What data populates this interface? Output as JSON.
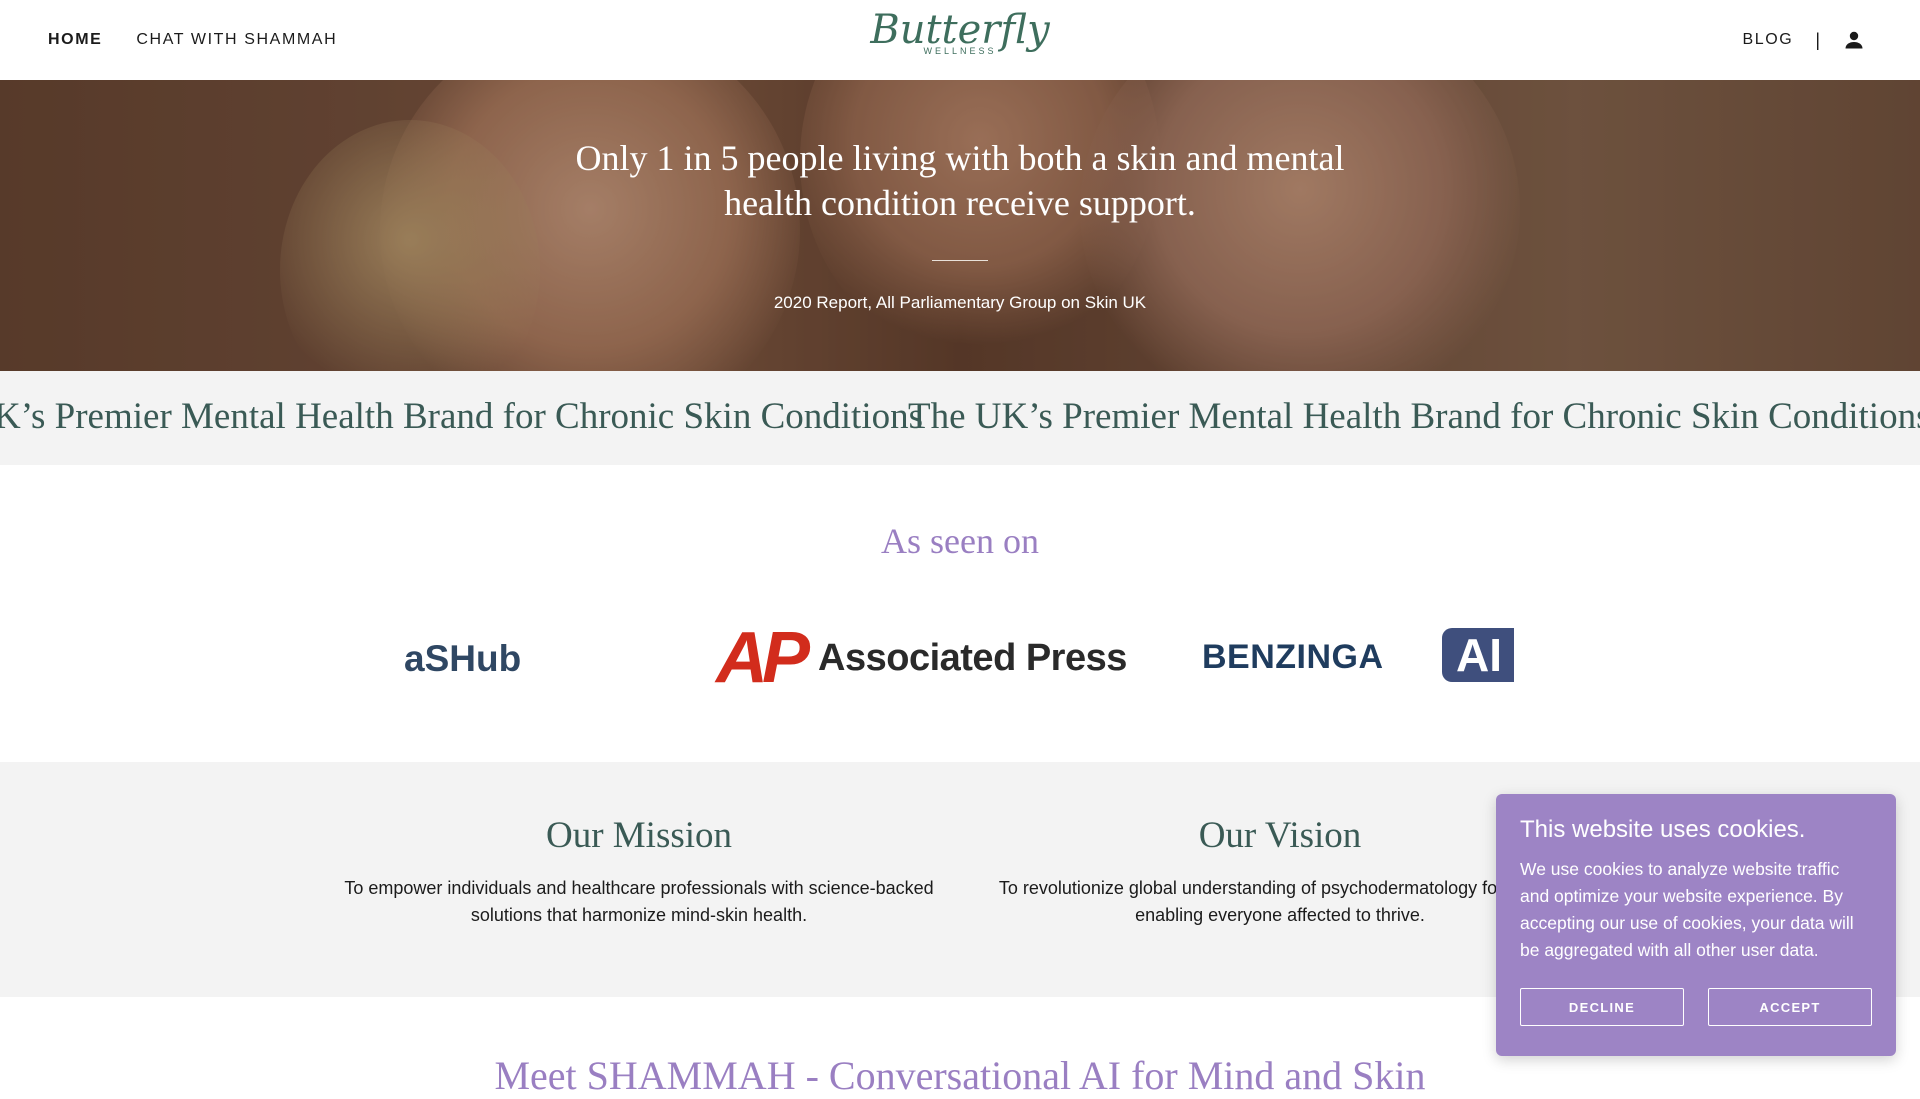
{
  "header": {
    "nav_left": [
      {
        "label": "HOME",
        "active": true
      },
      {
        "label": "CHAT WITH SHAMMAH",
        "active": false
      }
    ],
    "logo_word": "Butterfly",
    "logo_sub": "WELLNESS",
    "nav_right_blog": "BLOG",
    "separator": "|",
    "account_icon": "user-icon"
  },
  "hero": {
    "quote": "Only 1 in 5 people living with both a skin and mental health condition receive support.",
    "source": "2020 Report, All Parliamentary Group on Skin UK"
  },
  "marquee": {
    "items": [
      "K’s Premier Mental Health Brand for Chronic Skin Conditions",
      "The UK’s Premier Mental Health Brand for Chronic Skin Conditions"
    ]
  },
  "seen_on": {
    "title": "As seen on",
    "logos": {
      "partial_left": "aSHub",
      "ap_mark": "AP",
      "ap_text": "Associated Press",
      "benzinga": "BENZINGA",
      "partial_right": "AI"
    }
  },
  "mission": {
    "title": "Our Mission",
    "body": "To empower individuals and healthcare professionals with science-backed solutions that harmonize mind-skin health."
  },
  "vision": {
    "title": "Our Vision",
    "body": "To revolutionize global understanding of psychodermatology fo people, enabling everyone affected to thrive."
  },
  "meet_heading": "Meet SHAMMAH - Conversational AI for Mind and Skin",
  "cookie": {
    "title": "This website uses cookies.",
    "body": "We use cookies to analyze website traffic and optimize your website experience. By accepting our use of cookies, your data will be aggregated with all other user data.",
    "decline_label": "DECLINE",
    "accept_label": "ACCEPT"
  },
  "colors": {
    "brand_green": "#3e6e5d",
    "heading_teal": "#3a5a55",
    "accent_purple": "#9a7fc2",
    "cookie_bg": "#9d84c5",
    "ap_red": "#d22c1c"
  }
}
